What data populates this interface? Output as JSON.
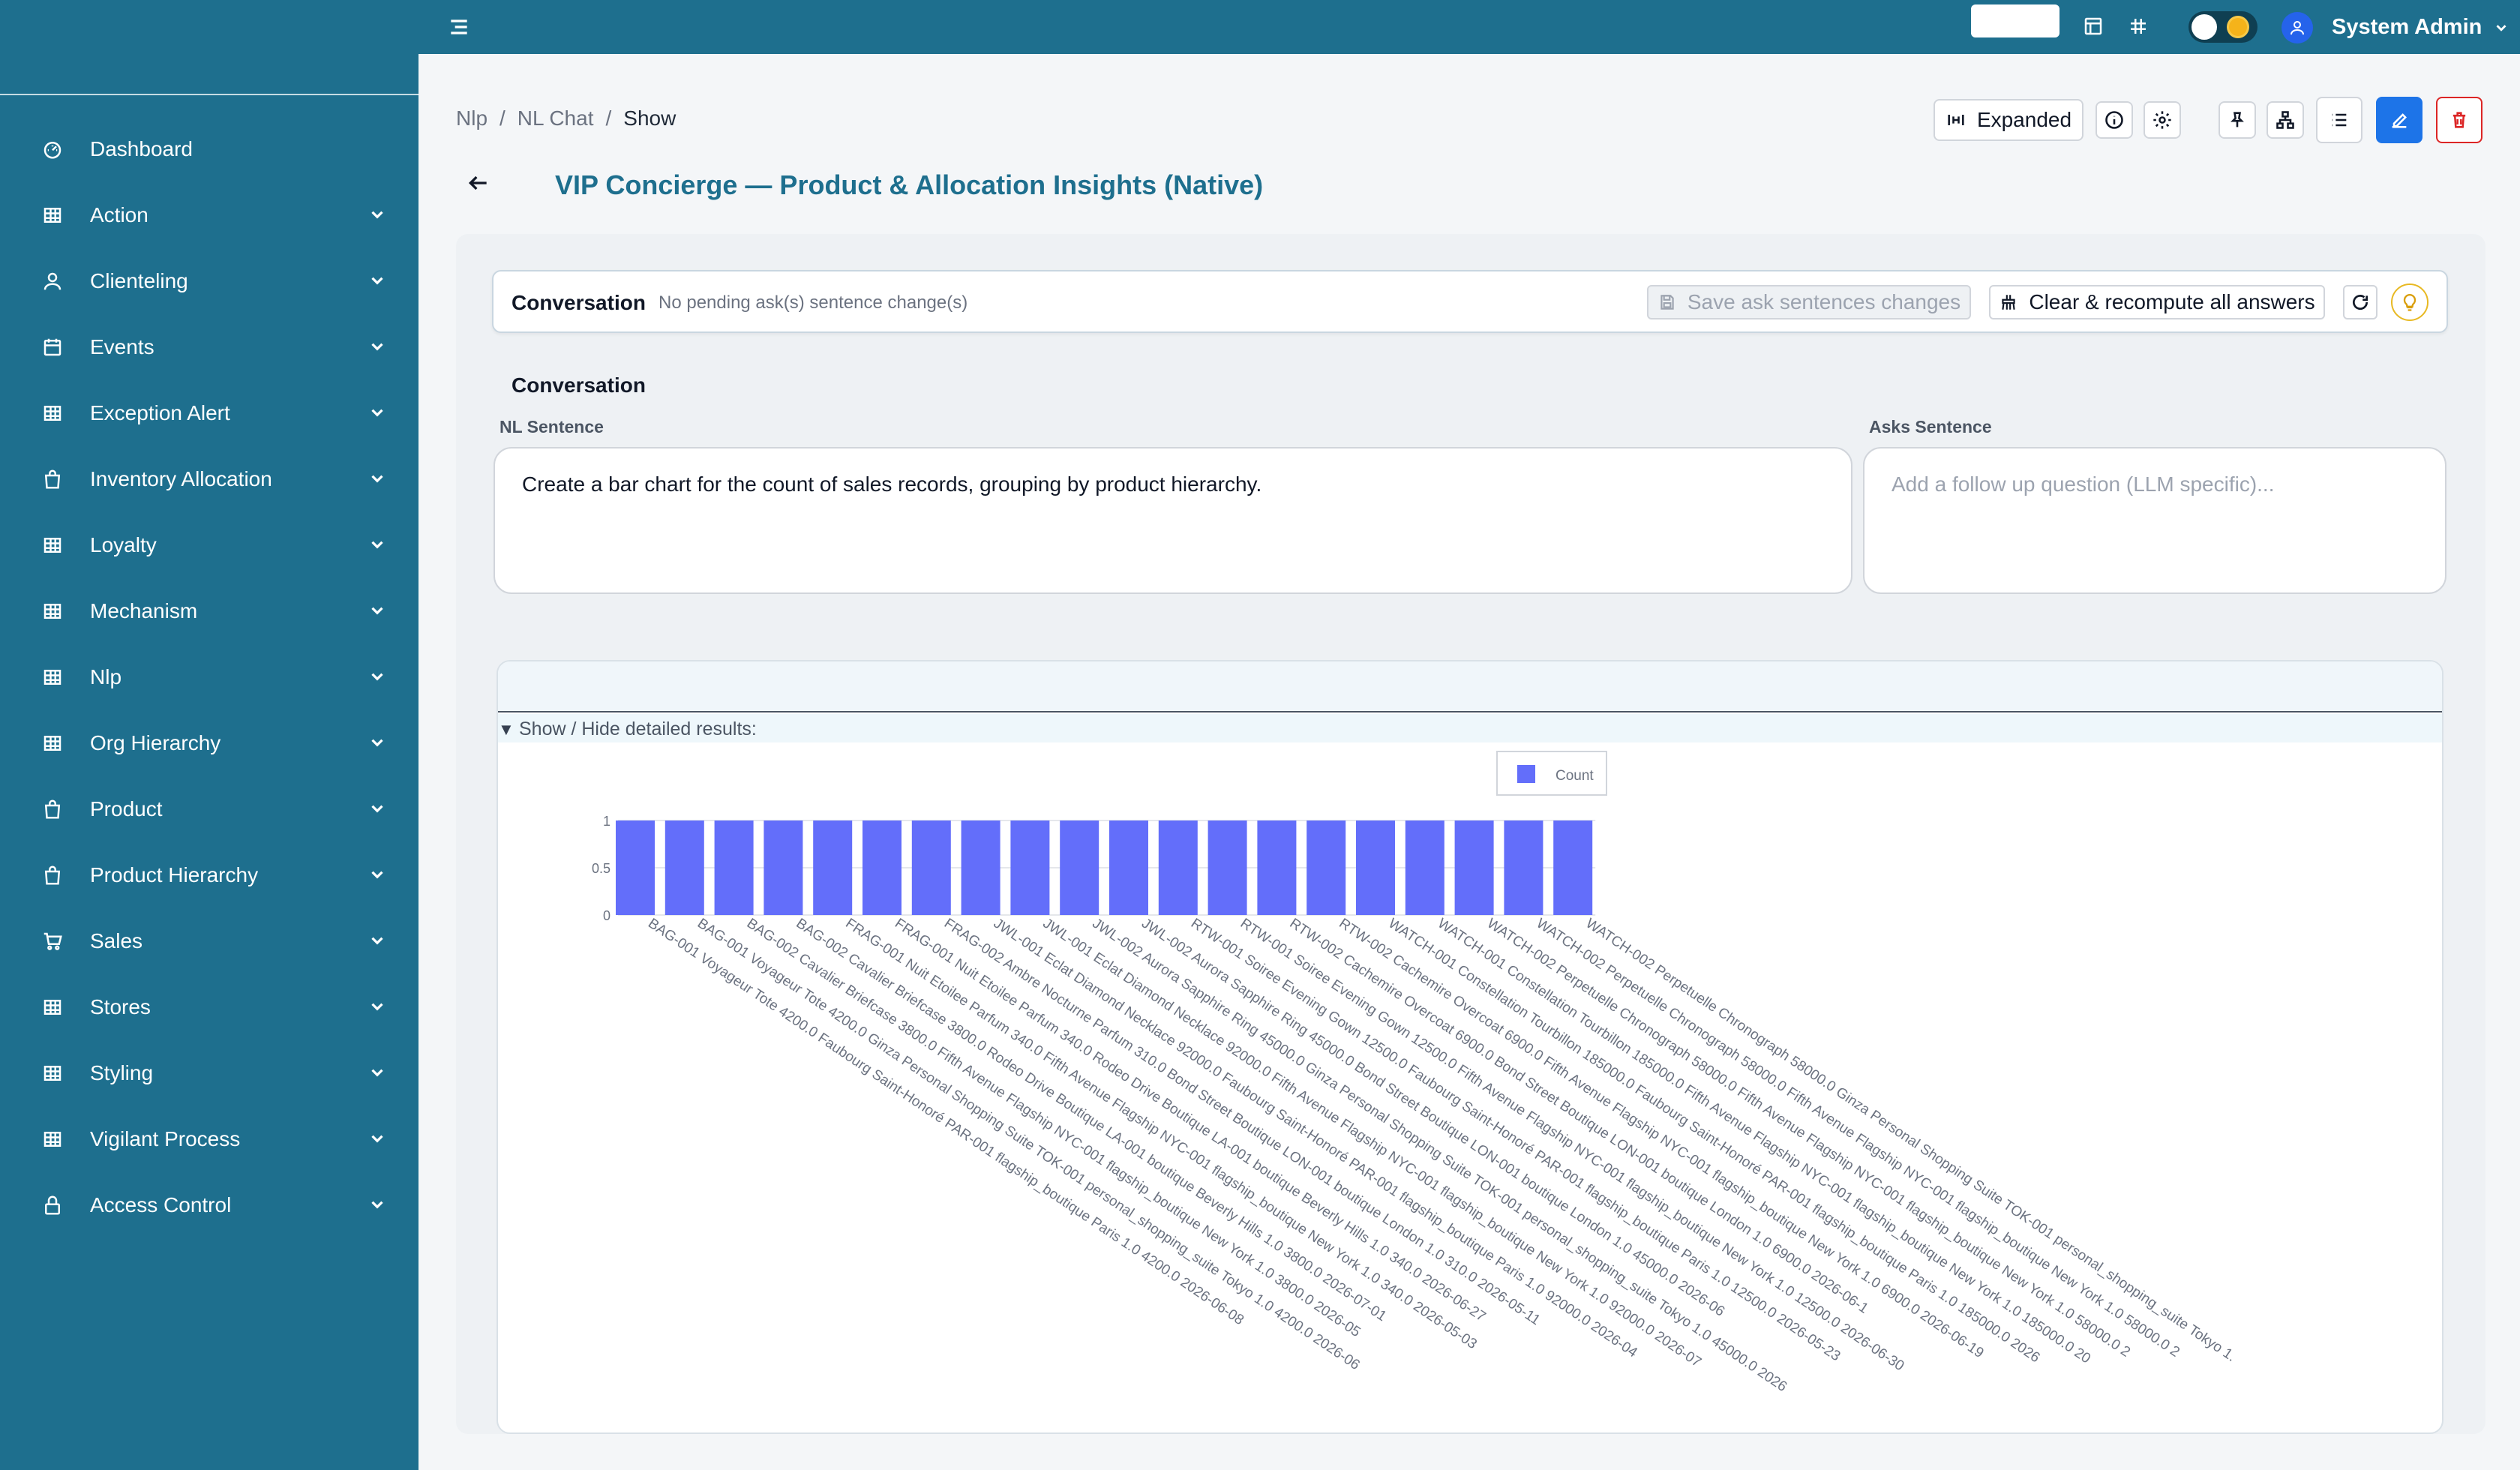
{
  "sidebar": {
    "items": [
      {
        "label": "Dashboard",
        "icon": "dashboard-icon",
        "has_children": false
      },
      {
        "label": "Action",
        "icon": "table-icon",
        "has_children": true
      },
      {
        "label": "Clienteling",
        "icon": "user-icon",
        "has_children": true
      },
      {
        "label": "Events",
        "icon": "calendar-icon",
        "has_children": true
      },
      {
        "label": "Exception Alert",
        "icon": "table-icon",
        "has_children": true
      },
      {
        "label": "Inventory Allocation",
        "icon": "bag-icon",
        "has_children": true
      },
      {
        "label": "Loyalty",
        "icon": "table-icon",
        "has_children": true
      },
      {
        "label": "Mechanism",
        "icon": "table-icon",
        "has_children": true
      },
      {
        "label": "Nlp",
        "icon": "table-icon",
        "has_children": true
      },
      {
        "label": "Org Hierarchy",
        "icon": "table-icon",
        "has_children": true
      },
      {
        "label": "Product",
        "icon": "bag-icon",
        "has_children": true
      },
      {
        "label": "Product Hierarchy",
        "icon": "bag-icon",
        "has_children": true
      },
      {
        "label": "Sales",
        "icon": "cart-icon",
        "has_children": true
      },
      {
        "label": "Stores",
        "icon": "table-icon",
        "has_children": true
      },
      {
        "label": "Styling",
        "icon": "table-icon",
        "has_children": true
      },
      {
        "label": "Vigilant Process",
        "icon": "table-icon",
        "has_children": true
      },
      {
        "label": "Access Control",
        "icon": "lock-icon",
        "has_children": true
      }
    ]
  },
  "topbar": {
    "user_name": "System Admin",
    "theme_toggle": "light",
    "colors": {
      "bar": "#1e6f8e"
    }
  },
  "breadcrumb": {
    "items": [
      "Nlp",
      "NL Chat"
    ],
    "current": "Show"
  },
  "toolbar": {
    "expanded_label": "Expanded"
  },
  "page": {
    "title": "VIP Concierge — Product & Allocation Insights (Native)"
  },
  "conversation_header": {
    "title": "Conversation",
    "status": "No pending ask(s) sentence change(s)",
    "save_label": "Save ask sentences changes",
    "recompute_label": "Clear & recompute all answers"
  },
  "conversation": {
    "section_title": "Conversation",
    "nl_label": "NL Sentence",
    "nl_value": "Create a bar chart for the count of sales records, grouping by product hierarchy.",
    "asks_label": "Asks Sentence",
    "asks_placeholder": "Add a follow up question (LLM specific)..."
  },
  "results": {
    "toggle_label": "Show / Hide detailed results:"
  },
  "chart_data": {
    "type": "bar",
    "series": [
      {
        "name": "Count",
        "color": "#636efa",
        "values": [
          1,
          1,
          1,
          1,
          1,
          1,
          1,
          1,
          1,
          1,
          1,
          1,
          1,
          1,
          1,
          1,
          1,
          1,
          1,
          1
        ]
      }
    ],
    "categories": [
      "BAG-001 Voyageur Tote 4200.0 Faubourg Saint-Honoré PAR-001 flagship_boutique Paris 1.0 4200.0 2026-06-08",
      "BAG-001 Voyageur Tote 4200.0 Ginza Personal Shopping Suite TOK-001 personal_shopping_suite Tokyo 1.0 4200.0 2026-06",
      "BAG-002 Cavalier Briefcase 3800.0 Fifth Avenue Flagship NYC-001 flagship_boutique New York 1.0 3800.0 2026-05",
      "BAG-002 Cavalier Briefcase 3800.0 Rodeo Drive Boutique LA-001 boutique Beverly Hills 1.0 3800.0 2026-07-01",
      "FRAG-001 Nuit Etoilee Parfum 340.0 Fifth Avenue Flagship NYC-001 flagship_boutique New York 1.0 340.0 2026-05-03",
      "FRAG-001 Nuit Etoilee Parfum 340.0 Rodeo Drive Boutique LA-001 boutique Beverly Hills 1.0 340.0 2026-06-27",
      "FRAG-002 Ambre Nocturne Parfum 310.0 Bond Street Boutique LON-001 boutique London 1.0 310.0 2026-05-11",
      "JWL-001 Eclat Diamond Necklace 92000.0 Faubourg Saint-Honoré PAR-001 flagship_boutique Paris 1.0 92000.0 2026-04",
      "JWL-001 Eclat Diamond Necklace 92000.0 Fifth Avenue Flagship NYC-001 flagship_boutique New York 1.0 92000.0 2026-07",
      "JWL-002 Aurora Sapphire Ring 45000.0 Ginza Personal Shopping Suite TOK-001 personal_shopping_suite Tokyo 1.0 45000.0 2026",
      "JWL-002 Aurora Sapphire Ring 45000.0 Bond Street Boutique LON-001 boutique London 1.0 45000.0 2026-06",
      "RTW-001 Soiree Evening Gown 12500.0 Faubourg Saint-Honoré PAR-001 flagship_boutique Paris 1.0 12500.0 2026-05-23",
      "RTW-001 Soiree Evening Gown 12500.0 Fifth Avenue Flagship NYC-001 flagship_boutique New York 1.0 12500.0 2026-06-30",
      "RTW-002 Cachemire Overcoat 6900.0 Bond Street Boutique LON-001 boutique London 1.0 6900.0 2026-06-1",
      "RTW-002 Cachemire Overcoat 6900.0 Fifth Avenue Flagship NYC-001 flagship_boutique New York 1.0 6900.0 2026-06-19",
      "WATCH-001 Constellation Tourbillon 185000.0 Faubourg Saint-Honoré PAR-001 flagship_boutique Paris 1.0 185000.0 2026",
      "WATCH-001 Constellation Tourbillon 185000.0 Fifth Avenue Flagship NYC-001 flagship_boutique New York 1.0 185000.0 20",
      "WATCH-002 Perpetuelle Chronograph 58000.0 Fifth Avenue Flagship NYC-001 flagship_boutique New York 1.0 58000.0 2",
      "WATCH-002 Perpetuelle Chronograph 58000.0 Fifth Avenue Flagship NYC-001 flagship_boutique New York 1.0 58000.0 2",
      "WATCH-002 Perpetuelle Chronograph 58000.0 Ginza Personal Shopping Suite TOK-001 personal_shopping_suite Tokyo 1."
    ],
    "yticks": [
      "0",
      "0.5",
      "1"
    ],
    "ylim": [
      0,
      1
    ],
    "legend": "top",
    "grid": true
  }
}
